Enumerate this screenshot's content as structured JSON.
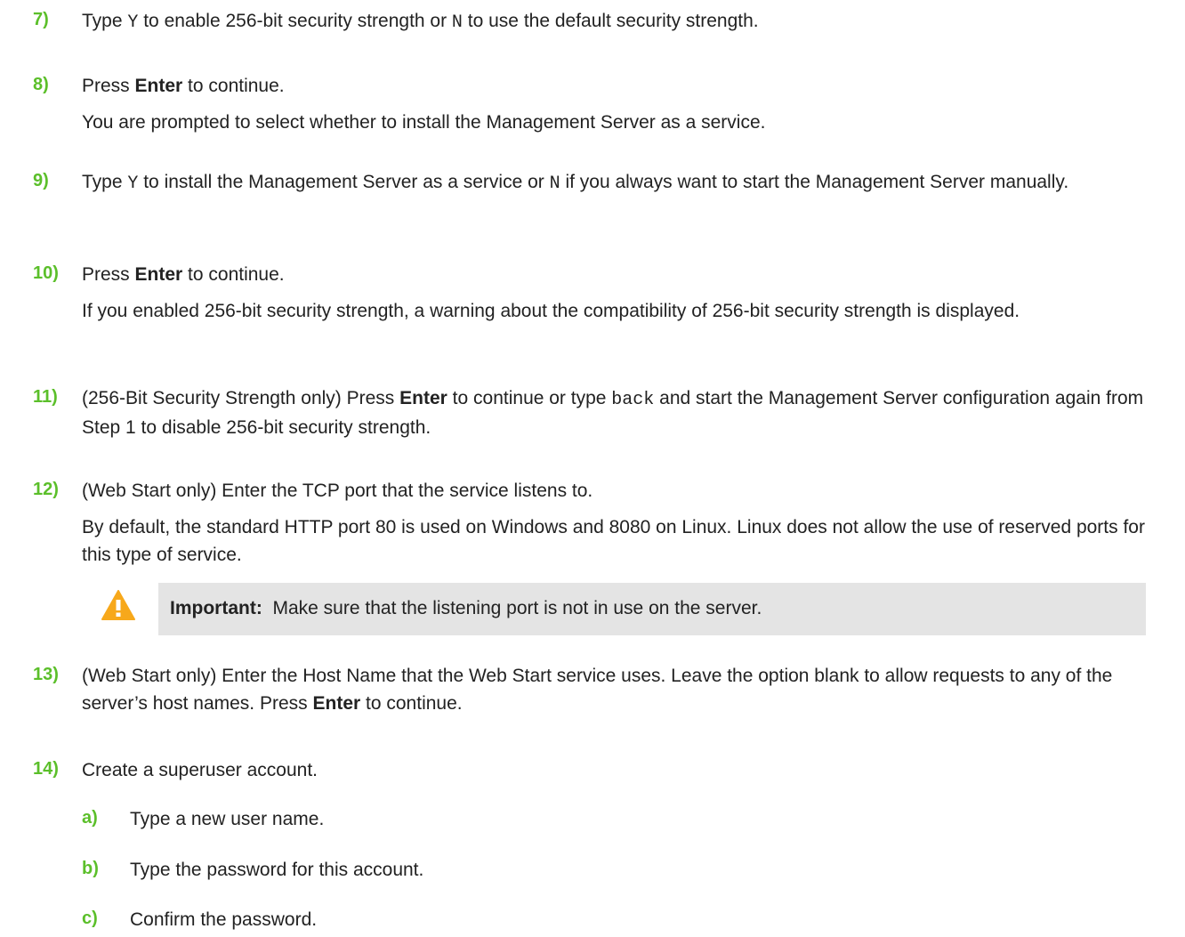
{
  "steps": [
    {
      "num": "7)",
      "parts": [
        "Type ",
        "Y",
        " to enable 256-bit security strength or ",
        "N",
        " to use the default security strength."
      ]
    },
    {
      "num": "8)",
      "pre": "Press ",
      "bold": "Enter",
      "post": " to continue.",
      "detail": "You are prompted to select whether to install the Management Server as a service."
    },
    {
      "num": "9)",
      "parts": [
        "Type ",
        "Y",
        " to install the Management Server as a service or ",
        "N",
        " if you always want to start the Management Server manually."
      ]
    },
    {
      "num": "10)",
      "pre": "Press ",
      "bold": "Enter",
      "post": " to continue.",
      "detail": "If you enabled 256-bit security strength, a warning about the compatibility of 256-bit security strength is displayed."
    },
    {
      "num": "11)",
      "pre": "(256-Bit Security Strength only) Press ",
      "bold": "Enter",
      "mid": " to continue or type ",
      "code": "back",
      "post": " and start the Management Server configuration again from Step 1 to disable 256-bit security strength."
    },
    {
      "num": "12)",
      "text": "(Web Start only) Enter the TCP port that the service listens to.",
      "detail": "By default, the standard HTTP port 80 is used on Windows and 8080 on Linux. Linux does not allow the use of reserved ports for this type of service."
    },
    {
      "num": "13)",
      "pre": "(Web Start only) Enter the Host Name that the Web Start service uses. Leave the option blank to allow requests to any of the server’s host names. Press ",
      "bold": "Enter",
      "post": " to continue."
    },
    {
      "num": "14)",
      "text": "Create a superuser account."
    }
  ],
  "note": {
    "label": "Important:",
    "text": "Make sure that the listening port is not in use on the server.",
    "icon": "warning-icon",
    "icon_color": "#f7a81b"
  },
  "substeps": [
    {
      "num": "a)",
      "text": "Type a new user name."
    },
    {
      "num": "b)",
      "text": "Type the password for this account."
    },
    {
      "num": "c)",
      "text": "Confirm the password."
    }
  ],
  "colors": {
    "step_number": "#5bbf2a",
    "note_background": "#e4e4e4"
  }
}
